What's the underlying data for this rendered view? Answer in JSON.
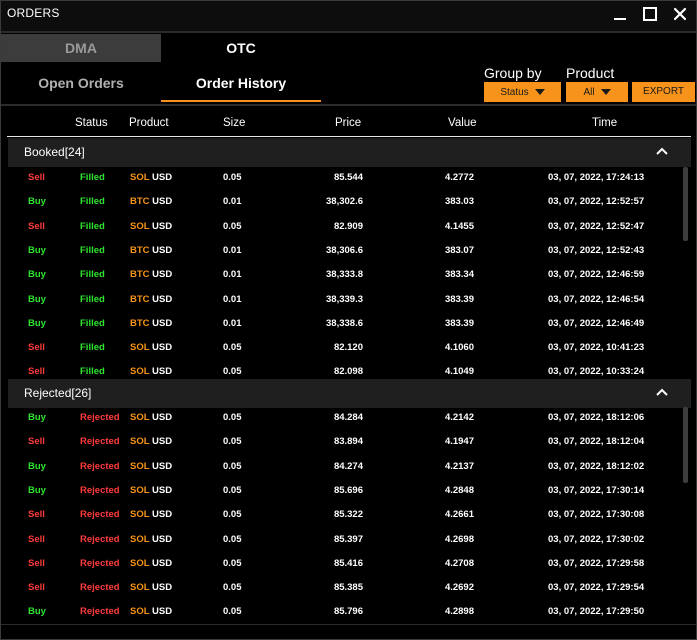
{
  "window": {
    "title": "ORDERS"
  },
  "tabs": {
    "dma": "DMA",
    "otc": "OTC"
  },
  "subtabs": {
    "open": "Open Orders",
    "history": "Order History"
  },
  "controls": {
    "group_by_label": "Group by",
    "group_by_value": "Status",
    "product_label": "Product",
    "product_value": "All",
    "export_label": "EXPORT"
  },
  "columns": [
    "Status",
    "Product",
    "Size",
    "Price",
    "Value",
    "Time"
  ],
  "groups": [
    {
      "title": "Booked[24]",
      "rows": [
        {
          "side": "Sell",
          "status": "Filled",
          "sym": "SOL",
          "quote": "USD",
          "size": "0.05",
          "price": "85.544",
          "value": "4.2772",
          "time": "03, 07, 2022, 17:24:13"
        },
        {
          "side": "Buy",
          "status": "Filled",
          "sym": "BTC",
          "quote": "USD",
          "size": "0.01",
          "price": "38,302.6",
          "value": "383.03",
          "time": "03, 07, 2022, 12:52:57"
        },
        {
          "side": "Sell",
          "status": "Filled",
          "sym": "SOL",
          "quote": "USD",
          "size": "0.05",
          "price": "82.909",
          "value": "4.1455",
          "time": "03, 07, 2022, 12:52:47"
        },
        {
          "side": "Buy",
          "status": "Filled",
          "sym": "BTC",
          "quote": "USD",
          "size": "0.01",
          "price": "38,306.6",
          "value": "383.07",
          "time": "03, 07, 2022, 12:52:43"
        },
        {
          "side": "Buy",
          "status": "Filled",
          "sym": "BTC",
          "quote": "USD",
          "size": "0.01",
          "price": "38,333.8",
          "value": "383.34",
          "time": "03, 07, 2022, 12:46:59"
        },
        {
          "side": "Buy",
          "status": "Filled",
          "sym": "BTC",
          "quote": "USD",
          "size": "0.01",
          "price": "38,339.3",
          "value": "383.39",
          "time": "03, 07, 2022, 12:46:54"
        },
        {
          "side": "Buy",
          "status": "Filled",
          "sym": "BTC",
          "quote": "USD",
          "size": "0.01",
          "price": "38,338.6",
          "value": "383.39",
          "time": "03, 07, 2022, 12:46:49"
        },
        {
          "side": "Sell",
          "status": "Filled",
          "sym": "SOL",
          "quote": "USD",
          "size": "0.05",
          "price": "82.120",
          "value": "4.1060",
          "time": "03, 07, 2022, 10:41:23"
        },
        {
          "side": "Sell",
          "status": "Filled",
          "sym": "SOL",
          "quote": "USD",
          "size": "0.05",
          "price": "82.098",
          "value": "4.1049",
          "time": "03, 07, 2022, 10:33:24"
        }
      ]
    },
    {
      "title": "Rejected[26]",
      "rows": [
        {
          "side": "Buy",
          "status": "Rejected",
          "sym": "SOL",
          "quote": "USD",
          "size": "0.05",
          "price": "84.284",
          "value": "4.2142",
          "time": "03, 07, 2022, 18:12:06"
        },
        {
          "side": "Sell",
          "status": "Rejected",
          "sym": "SOL",
          "quote": "USD",
          "size": "0.05",
          "price": "83.894",
          "value": "4.1947",
          "time": "03, 07, 2022, 18:12:04"
        },
        {
          "side": "Buy",
          "status": "Rejected",
          "sym": "SOL",
          "quote": "USD",
          "size": "0.05",
          "price": "84.274",
          "value": "4.2137",
          "time": "03, 07, 2022, 18:12:02"
        },
        {
          "side": "Buy",
          "status": "Rejected",
          "sym": "SOL",
          "quote": "USD",
          "size": "0.05",
          "price": "85.696",
          "value": "4.2848",
          "time": "03, 07, 2022, 17:30:14"
        },
        {
          "side": "Sell",
          "status": "Rejected",
          "sym": "SOL",
          "quote": "USD",
          "size": "0.05",
          "price": "85.322",
          "value": "4.2661",
          "time": "03, 07, 2022, 17:30:08"
        },
        {
          "side": "Sell",
          "status": "Rejected",
          "sym": "SOL",
          "quote": "USD",
          "size": "0.05",
          "price": "85.397",
          "value": "4.2698",
          "time": "03, 07, 2022, 17:30:02"
        },
        {
          "side": "Sell",
          "status": "Rejected",
          "sym": "SOL",
          "quote": "USD",
          "size": "0.05",
          "price": "85.416",
          "value": "4.2708",
          "time": "03, 07, 2022, 17:29:58"
        },
        {
          "side": "Sell",
          "status": "Rejected",
          "sym": "SOL",
          "quote": "USD",
          "size": "0.05",
          "price": "85.385",
          "value": "4.2692",
          "time": "03, 07, 2022, 17:29:54"
        },
        {
          "side": "Buy",
          "status": "Rejected",
          "sym": "SOL",
          "quote": "USD",
          "size": "0.05",
          "price": "85.796",
          "value": "4.2898",
          "time": "03, 07, 2022, 17:29:50"
        }
      ]
    }
  ],
  "colors": {
    "accent": "#f7931a",
    "buy": "#2ee52e",
    "sell": "#ff3b3b",
    "background": "#000000",
    "group_header": "#1f1f1f"
  }
}
